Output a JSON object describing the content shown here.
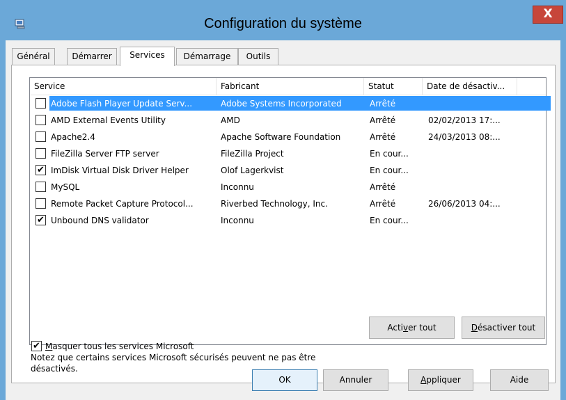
{
  "window": {
    "title": "Configuration du système",
    "close_label": "X"
  },
  "tabs": [
    {
      "label": "Général",
      "active": false
    },
    {
      "label": "Démarrer",
      "active": false
    },
    {
      "label": "Services",
      "active": true
    },
    {
      "label": "Démarrage",
      "active": false
    },
    {
      "label": "Outils",
      "active": false
    }
  ],
  "services_table": {
    "columns": [
      "Service",
      "Fabricant",
      "Statut",
      "Date de désactiv..."
    ],
    "rows": [
      {
        "checked": false,
        "service": "Adobe Flash Player Update Serv...",
        "fabricant": "Adobe Systems Incorporated",
        "statut": "Arrêté",
        "date": "",
        "selected": true
      },
      {
        "checked": false,
        "service": "AMD External Events Utility",
        "fabricant": "AMD",
        "statut": "Arrêté",
        "date": "02/02/2013 17:...",
        "selected": false
      },
      {
        "checked": false,
        "service": "Apache2.4",
        "fabricant": "Apache Software Foundation",
        "statut": "Arrêté",
        "date": "24/03/2013 08:...",
        "selected": false
      },
      {
        "checked": false,
        "service": "FileZilla Server FTP server",
        "fabricant": "FileZilla Project",
        "statut": "En cour...",
        "date": "",
        "selected": false
      },
      {
        "checked": true,
        "service": "ImDisk Virtual Disk Driver Helper",
        "fabricant": "Olof Lagerkvist",
        "statut": "En cour...",
        "date": "",
        "selected": false
      },
      {
        "checked": false,
        "service": "MySQL",
        "fabricant": "Inconnu",
        "statut": "Arrêté",
        "date": "",
        "selected": false
      },
      {
        "checked": false,
        "service": "Remote Packet Capture Protocol...",
        "fabricant": "Riverbed Technology, Inc.",
        "statut": "Arrêté",
        "date": "26/06/2013 04:...",
        "selected": false
      },
      {
        "checked": true,
        "service": "Unbound DNS validator",
        "fabricant": "Inconnu",
        "statut": "En cour...",
        "date": "",
        "selected": false
      }
    ]
  },
  "note": "Notez que certains services Microsoft sécurisés peuvent ne pas être désactivés.",
  "buttons": {
    "enable_all": {
      "pre": "Acti",
      "accel": "v",
      "post": "er tout"
    },
    "disable_all": {
      "pre": "",
      "accel": "D",
      "post": "ésactiver tout"
    },
    "ok": "OK",
    "cancel": "Annuler",
    "apply": {
      "pre": "",
      "accel": "A",
      "post": "ppliquer"
    },
    "help": "Aide"
  },
  "hide_ms": {
    "checked": true,
    "pre": "",
    "accel": "M",
    "post": "asquer tous les services Microsoft"
  },
  "colors": {
    "title_bar": "#6ba8d8",
    "selection": "#3399ff",
    "close_button": "#c7463a"
  }
}
